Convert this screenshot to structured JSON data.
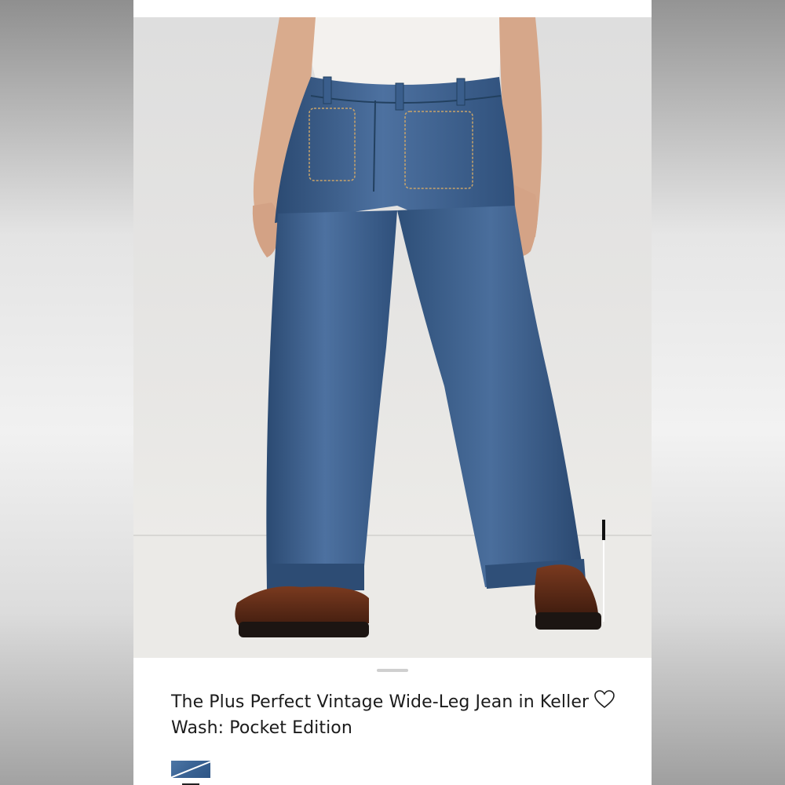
{
  "product": {
    "title": "The Plus Perfect Vintage Wide-Leg Jean in Keller Wash: Pocket Edition",
    "image_alt": "Model wearing wide-leg medium wash jeans with front patch pockets and brown loafers"
  },
  "controls": {
    "close_icon": "close-icon",
    "wishlist_icon": "heart-outline-icon",
    "zoom_level": 0.2
  },
  "swatches": [
    {
      "name": "denim-swatch",
      "color": "#3d6696",
      "selected": true
    }
  ],
  "colors": {
    "background": "#ffffff",
    "text": "#1b1b1b",
    "denim": "#34567e",
    "leather": "#5a2a17"
  }
}
